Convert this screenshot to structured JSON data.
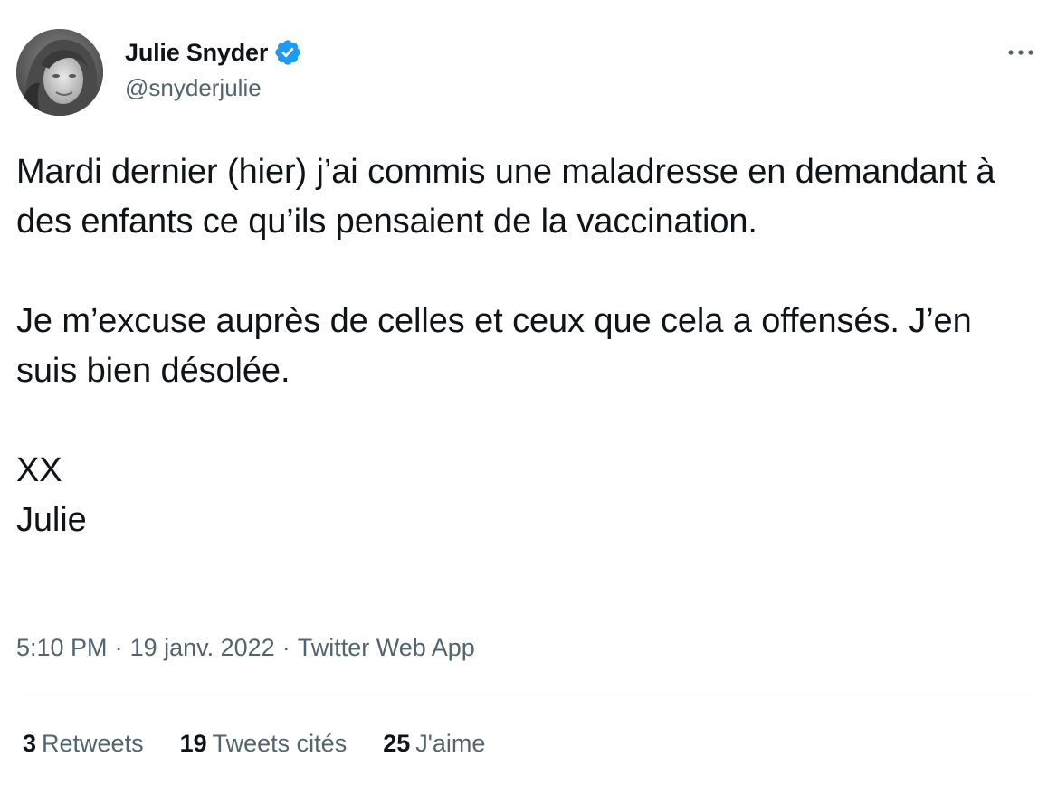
{
  "author": {
    "name": "Julie Snyder",
    "handle": "@snyderjulie",
    "verified": true,
    "avatar_icon": "profile-photo"
  },
  "menu": {
    "more_icon": "more-horizontal-icon"
  },
  "tweet": {
    "paragraph1": "Mardi dernier (hier) j’ai commis une maladresse en demandant à des enfants ce qu’ils pensaient de la vaccination.",
    "paragraph2": "Je m’excuse auprès de celles et ceux que cela a offensés. J’en suis bien désolée.",
    "signoff_line1": "XX",
    "signoff_line2": "Julie"
  },
  "meta": {
    "time": "5:10 PM",
    "separator": "·",
    "date": "19 janv. 2022",
    "source": "Twitter Web App"
  },
  "stats": {
    "retweets_count": "3",
    "retweets_label": "Retweets",
    "quotes_count": "19",
    "quotes_label": "Tweets cités",
    "likes_count": "25",
    "likes_label": "J'aime"
  },
  "colors": {
    "text_primary": "#0f1419",
    "text_secondary": "#536471",
    "verified_blue": "#1d9bf0",
    "divider": "#eff3f4"
  }
}
